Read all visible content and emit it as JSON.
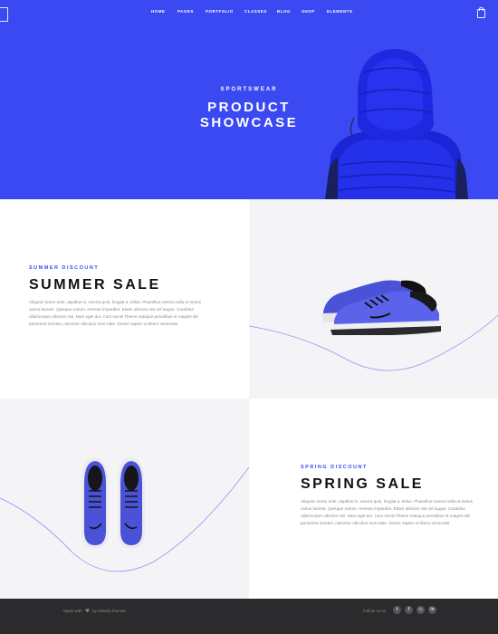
{
  "nav": {
    "items": [
      "Home",
      "Pages",
      "Portfolio",
      "Classes",
      "Blog",
      "Shop",
      "Elements"
    ]
  },
  "hero": {
    "kicker": "SPORTSWEAR",
    "title": "PRODUCT SHOWCASE"
  },
  "sections": [
    {
      "kicker": "SUMMER DISCOUNT",
      "title": "SUMMER SALE",
      "body": "Aliquam lorem ante, dapibus in, viverra quis, feugiat a, tellus. Phasellus viverra nulla ut metus varius laoreet. Quisque rutrum. Aenean imperdiet. Etiam ultricies nisi vel augue. Curabitur ullamcorper ultricies nisi. Nam eget dui. Cum sociis Theme natoque penatibus et magnis dis parturient montes, nascetur ridiculus mus vitae. Donec sapien ut libero venenatis."
    },
    {
      "kicker": "SPRING DISCOUNT",
      "title": "SPRING SALE",
      "body": "Aliquam lorem ante, dapibus in, viverra quis, feugiat a, tellus. Phasellus viverra nulla ut metus varius laoreet. Quisque rutrum. Aenean imperdiet. Etiam ultricies nisi vel augue. Curabitur ullamcorper ultricies nisi. Nam eget dui. Cum sociis Theme natoque penatibus et magnis dis parturient montes, nascetur ridiculus mus vitae. Donec sapien ut libero venenatis."
    }
  ],
  "footer": {
    "made_with": "Made with",
    "made_by": "by Mikado-themes",
    "follow": "Follow us on",
    "social": [
      "twitter-icon",
      "facebook-icon",
      "instagram-icon",
      "linkedin-icon"
    ]
  },
  "colors": {
    "accent": "#3b49f2",
    "footer": "#2b2b2d"
  }
}
